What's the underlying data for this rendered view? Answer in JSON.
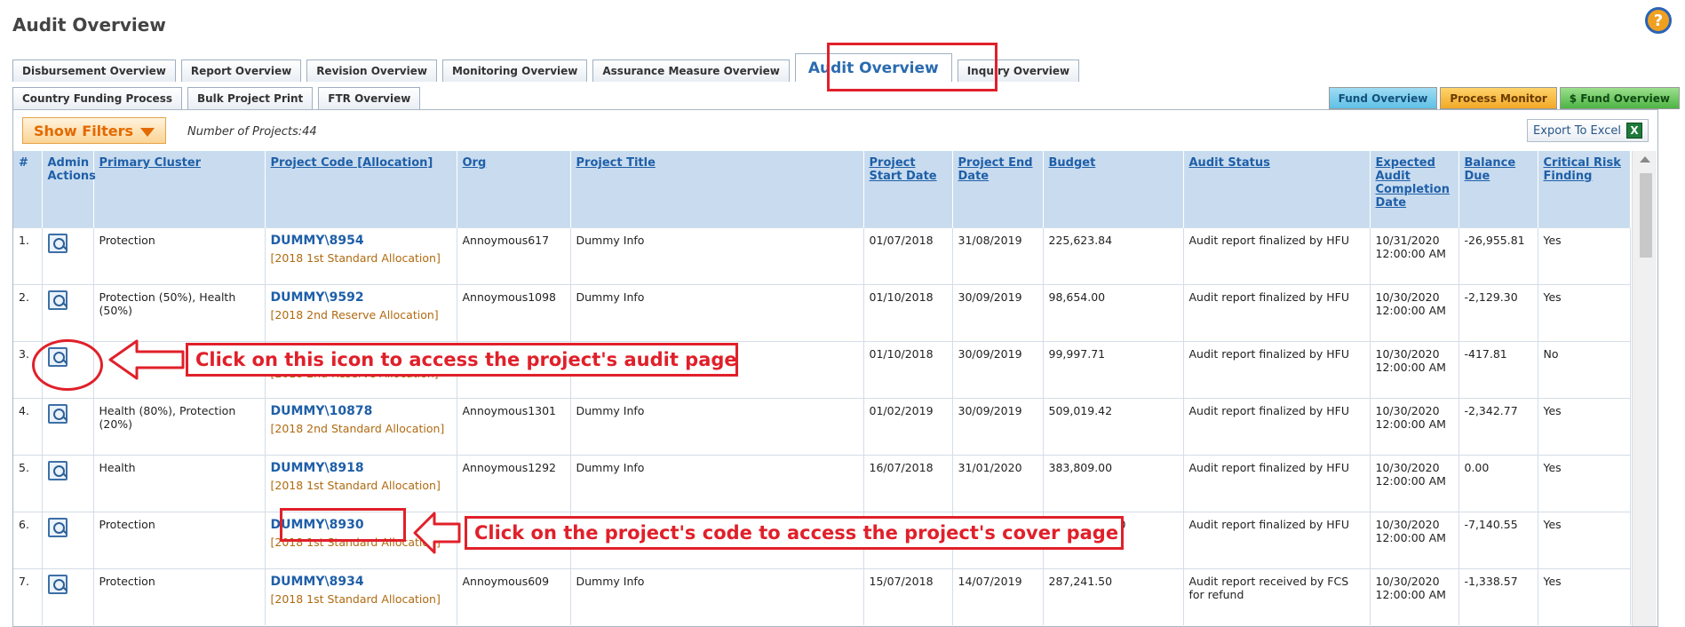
{
  "page": {
    "title": "Audit Overview",
    "help_label": "?"
  },
  "tabs_row1": [
    {
      "label": "Disbursement Overview"
    },
    {
      "label": "Report Overview"
    },
    {
      "label": "Revision Overview"
    },
    {
      "label": "Monitoring Overview"
    },
    {
      "label": "Assurance Measure Overview"
    },
    {
      "label": "Audit Overview",
      "active": true
    },
    {
      "label": "Inquiry Overview"
    }
  ],
  "tabs_row2": [
    {
      "label": "Country Funding Process"
    },
    {
      "label": "Bulk Project Print"
    },
    {
      "label": "FTR Overview"
    }
  ],
  "right_tabs": {
    "fund": "Fund Overview",
    "process": "Process Monitor",
    "sfund": "$ Fund Overview"
  },
  "toolbar": {
    "filters_label": "Show Filters",
    "num_projects": "Number of Projects:44",
    "export_label": "Export To Excel",
    "excel_glyph": "X"
  },
  "columns": [
    "#",
    "Admin Actions",
    "Primary Cluster",
    "Project Code [Allocation]",
    "Org",
    "Project Title",
    "Project Start Date",
    "Project End Date",
    "Budget",
    "Audit Status",
    "Expected Audit Completion Date",
    "Balance Due",
    "Critical Risk Finding"
  ],
  "rows": [
    {
      "num": "1.",
      "cluster": "Protection",
      "code": "DUMMY\\8954",
      "alloc": "[2018 1st Standard Allocation]",
      "org": "Annoymous617",
      "title": "Dummy Info",
      "start": "01/07/2018",
      "end": "31/08/2019",
      "budget": "225,623.84",
      "status": "Audit report finalized by HFU",
      "expected": "10/31/2020 12:00:00 AM",
      "balance": "-26,955.81",
      "critical": "Yes"
    },
    {
      "num": "2.",
      "cluster": "Protection (50%), Health (50%)",
      "code": "DUMMY\\9592",
      "alloc": "[2018 2nd Reserve Allocation]",
      "org": "Annoymous1098",
      "title": "Dummy Info",
      "start": "01/10/2018",
      "end": "30/09/2019",
      "budget": "98,654.00",
      "status": "Audit report finalized by HFU",
      "expected": "10/30/2020 12:00:00 AM",
      "balance": "-2,129.30",
      "critical": "Yes"
    },
    {
      "num": "3.",
      "cluster": "",
      "code": "",
      "alloc": "[2018 2nd Reserve Allocation]",
      "org": "",
      "title": "",
      "start": "01/10/2018",
      "end": "30/09/2019",
      "budget": "99,997.71",
      "status": "Audit report finalized by HFU",
      "expected": "10/30/2020 12:00:00 AM",
      "balance": "-417.81",
      "critical": "No"
    },
    {
      "num": "4.",
      "cluster": "Health (80%), Protection (20%)",
      "code": "DUMMY\\10878",
      "alloc": "[2018 2nd Standard Allocation]",
      "org": "Annoymous1301",
      "title": "Dummy Info",
      "start": "01/02/2019",
      "end": "30/09/2019",
      "budget": "509,019.42",
      "status": "Audit report finalized by HFU",
      "expected": "10/30/2020 12:00:00 AM",
      "balance": "-2,342.77",
      "critical": "Yes"
    },
    {
      "num": "5.",
      "cluster": "Health",
      "code": "DUMMY\\8918",
      "alloc": "[2018 1st Standard Allocation]",
      "org": "Annoymous1292",
      "title": "Dummy Info",
      "start": "16/07/2018",
      "end": "31/01/2020",
      "budget": "383,809.00",
      "status": "Audit report finalized by HFU",
      "expected": "10/30/2020 12:00:00 AM",
      "balance": "0.00",
      "critical": "Yes"
    },
    {
      "num": "6.",
      "cluster": "Protection",
      "code": "DUMMY\\8930",
      "alloc": "[2018 1st Standard Allocation]",
      "org": "",
      "title": "",
      "start": "",
      "end": "",
      "budget": "00",
      "status": "Audit report finalized by HFU",
      "expected": "10/30/2020 12:00:00 AM",
      "balance": "-7,140.55",
      "critical": "Yes"
    },
    {
      "num": "7.",
      "cluster": "Protection",
      "code": "DUMMY\\8934",
      "alloc": "[2018 1st Standard Allocation]",
      "org": "Annoymous609",
      "title": "Dummy Info",
      "start": "15/07/2018",
      "end": "14/07/2019",
      "budget": "287,241.50",
      "status": "Audit report received by FCS for refund",
      "expected": "10/30/2020 12:00:00 AM",
      "balance": "-1,338.57",
      "critical": "Yes"
    }
  ],
  "annotations": {
    "icon_note": "Click on this icon to access the project's audit page",
    "code_note": "Click on the project's code to access the project's cover page"
  },
  "colors": {
    "annotation_red": "#e0202a",
    "link_blue": "#1f5fa8",
    "alloc_orange": "#b06a10",
    "header_bg": "#c9dcef"
  }
}
